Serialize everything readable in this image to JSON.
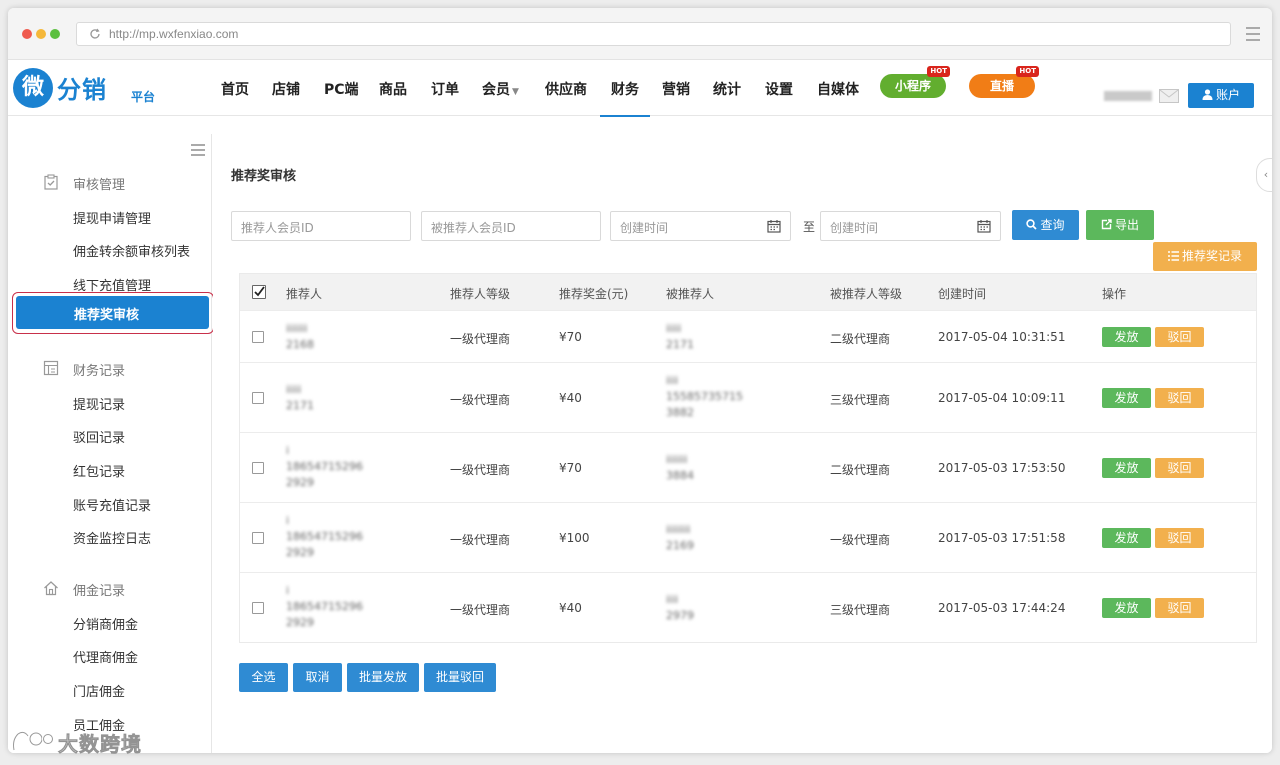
{
  "browser": {
    "url": "http://mp.wxfenxiao.com"
  },
  "logo": {
    "mark": "微",
    "main": "分销",
    "sub": "平台"
  },
  "nav": {
    "items": [
      "首页",
      "店铺",
      "PC端",
      "商品",
      "订单",
      "会员",
      "供应商",
      "财务",
      "营销",
      "统计",
      "设置",
      "自媒体"
    ],
    "active": "财务",
    "mini_program": "小程序",
    "live": "直播",
    "hot_badge": "HOT",
    "account": "账户"
  },
  "sidebar": {
    "sections": [
      {
        "title": "审核管理",
        "items": [
          "提现申请管理",
          "佣金转余额审核列表",
          "线下充值管理",
          "推荐奖审核"
        ]
      },
      {
        "title": "财务记录",
        "items": [
          "提现记录",
          "驳回记录",
          "红包记录",
          "账号充值记录",
          "资金监控日志"
        ]
      },
      {
        "title": "佣金记录",
        "items": [
          "分销商佣金",
          "代理商佣金",
          "门店佣金",
          "员工佣金"
        ]
      }
    ],
    "active_item": "推荐奖审核"
  },
  "page": {
    "title": "推荐奖审核",
    "filters": {
      "referrer_id_placeholder": "推荐人会员ID",
      "referee_id_placeholder": "被推荐人会员ID",
      "start_placeholder": "创建时间",
      "to": "至",
      "end_placeholder": "创建时间"
    },
    "buttons": {
      "query": "查询",
      "export": "导出",
      "records": "推荐奖记录"
    }
  },
  "table": {
    "headers": [
      "推荐人",
      "推荐人等级",
      "推荐奖金(元)",
      "被推荐人",
      "被推荐人等级",
      "创建时间",
      "操作"
    ],
    "rows": [
      {
        "referrer": "iiiiiii\n2168",
        "referrer_level": "一级代理商",
        "bonus": "¥70",
        "referee": "iiiii\n2171",
        "referee_level": "二级代理商",
        "created": "2017-05-04 10:31:51"
      },
      {
        "referrer": "iiiii\n2171",
        "referrer_level": "一级代理商",
        "bonus": "¥40",
        "referee": "iiii\n15585735715\n3882",
        "referee_level": "三级代理商",
        "created": "2017-05-04 10:09:11"
      },
      {
        "referrer": "i\n18654715296\n2929",
        "referrer_level": "一级代理商",
        "bonus": "¥70",
        "referee": "iiiiiii\n3884",
        "referee_level": "二级代理商",
        "created": "2017-05-03 17:53:50"
      },
      {
        "referrer": "i\n18654715296\n2929",
        "referrer_level": "一级代理商",
        "bonus": "¥100",
        "referee": "iiiiiiii\n2169",
        "referee_level": "一级代理商",
        "created": "2017-05-03 17:51:58"
      },
      {
        "referrer": "i\n18654715296\n2929",
        "referrer_level": "一级代理商",
        "bonus": "¥40",
        "referee": "iiii\n2979",
        "referee_level": "三级代理商",
        "created": "2017-05-03 17:44:24"
      }
    ],
    "release": "发放",
    "reject": "驳回"
  },
  "bulk": {
    "select_all": "全选",
    "cancel": "取消",
    "bulk_release": "批量发放",
    "bulk_reject": "批量驳回"
  },
  "watermark": "大数跨境",
  "colors": {
    "primary": "#1b82d1",
    "success": "#5cb85c",
    "warning": "#f2b04d",
    "mini_program": "#62ae2f",
    "live": "#f17d16",
    "hot": "#d9251c"
  }
}
